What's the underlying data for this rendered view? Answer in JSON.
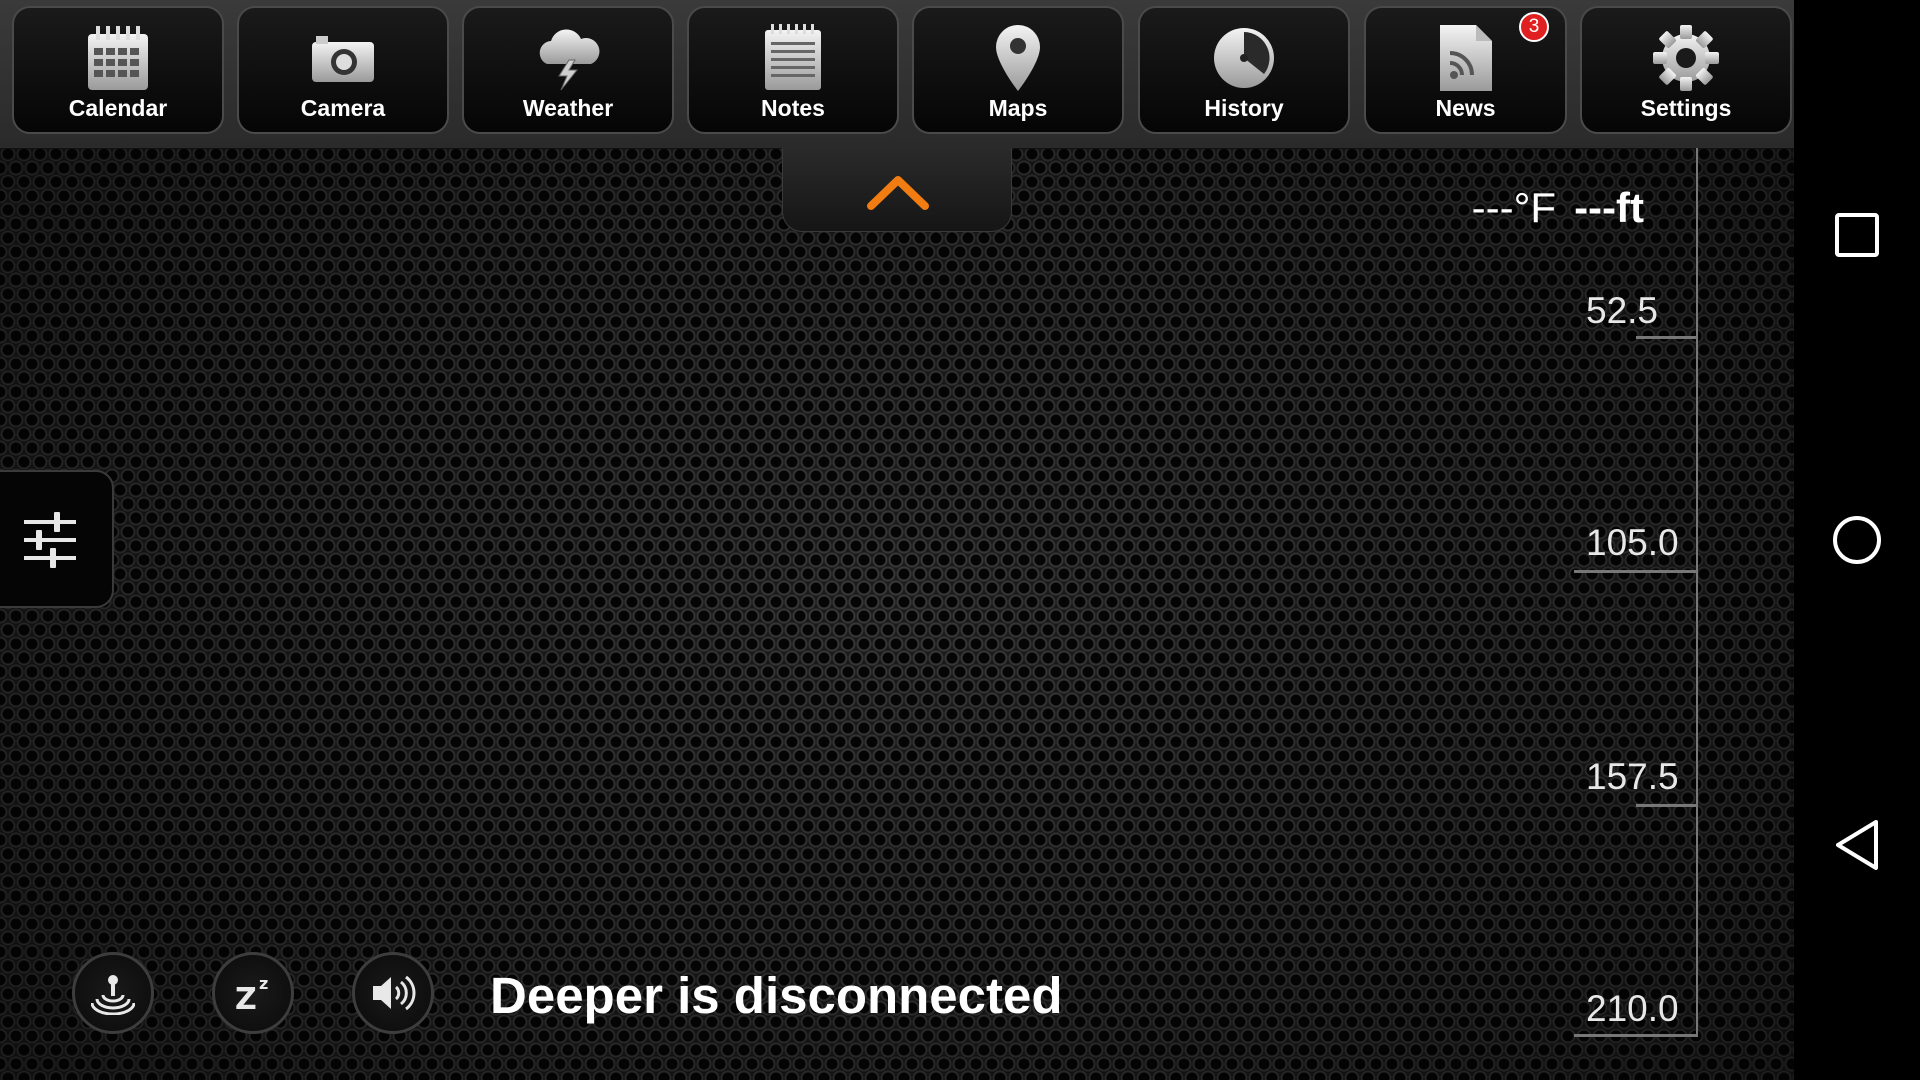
{
  "apps": [
    {
      "label": "Calendar",
      "icon": "calendar-icon"
    },
    {
      "label": "Camera",
      "icon": "camera-icon"
    },
    {
      "label": "Weather",
      "icon": "weather-icon"
    },
    {
      "label": "Notes",
      "icon": "notes-icon"
    },
    {
      "label": "Maps",
      "icon": "map-pin-icon"
    },
    {
      "label": "History",
      "icon": "history-icon"
    },
    {
      "label": "News",
      "icon": "rss-document-icon",
      "badge": "3"
    },
    {
      "label": "Settings",
      "icon": "gear-icon"
    }
  ],
  "readout": {
    "temperature": "---°F",
    "depth": "---ft"
  },
  "depth_scale": {
    "ticks": [
      "52.5",
      "105.0",
      "157.5",
      "210.0"
    ]
  },
  "status_text": "Deeper is disconnected",
  "bottom_controls": [
    "sonar-icon",
    "sleep-icon",
    "volume-icon"
  ],
  "navbar": [
    "recents-icon",
    "home-icon",
    "back-icon"
  ],
  "colors": {
    "accent": "#f07c12",
    "badge": "#e02020",
    "text": "#ffffff"
  }
}
